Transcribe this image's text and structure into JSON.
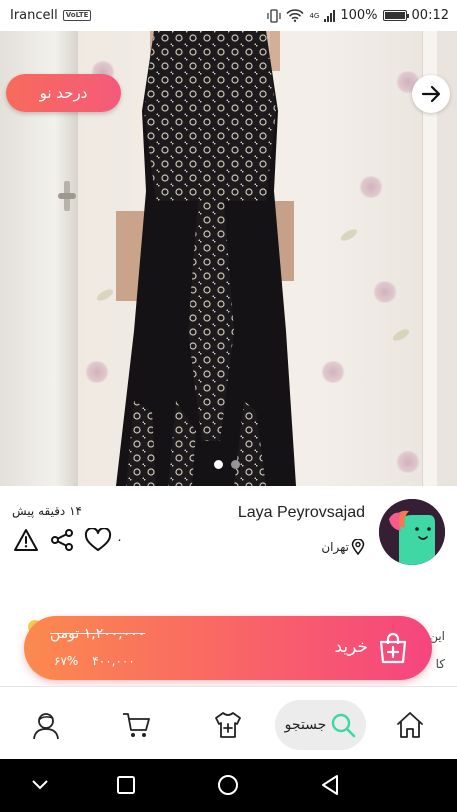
{
  "status_bar": {
    "carrier": "Irancell",
    "volte": "VoLTE",
    "network": "4G",
    "battery": "100%",
    "time": "00:12"
  },
  "product": {
    "discount_badge": "درحد نو",
    "image_count": 2,
    "active_image": 1
  },
  "post": {
    "time_ago": "۱۴ دقیقه پیش",
    "like_count": "۰",
    "description_line1": "این",
    "description_line2": "کا"
  },
  "seller": {
    "name": "Laya Peyrovsajad",
    "location": "تهران"
  },
  "buy_bar": {
    "label": "خرید",
    "old_price": "۱,۲۰۰,۰۰۰ تومن",
    "discount_percent": "۶۷%",
    "new_price": "۴۰۰,۰۰۰"
  },
  "bottom_nav": {
    "search_label": "جستجو"
  },
  "colors": {
    "accent_start": "#fb8a4d",
    "accent_end": "#f5457f",
    "active_green": "#3fd7a3"
  }
}
